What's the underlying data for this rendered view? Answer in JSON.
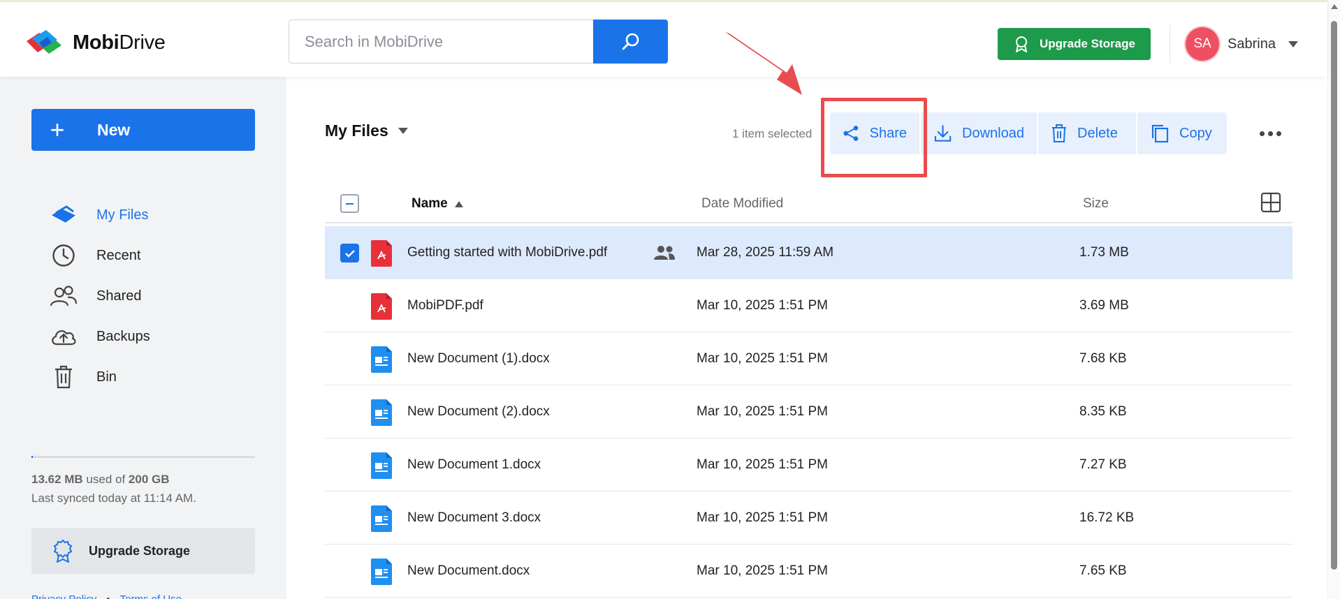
{
  "app": {
    "name_bold": "Mobi",
    "name_rest": "Drive"
  },
  "header": {
    "search_placeholder": "Search in MobiDrive",
    "upgrade_label": "Upgrade Storage",
    "user_initials": "SA",
    "user_name": "Sabrina"
  },
  "sidebar": {
    "new_label": "New",
    "items": [
      {
        "label": "My Files",
        "icon": "cloud-icon",
        "active": true
      },
      {
        "label": "Recent",
        "icon": "clock-icon",
        "active": false
      },
      {
        "label": "Shared",
        "icon": "people-icon",
        "active": false
      },
      {
        "label": "Backups",
        "icon": "cloud-upload-icon",
        "active": false
      },
      {
        "label": "Bin",
        "icon": "trash-icon",
        "active": false
      }
    ],
    "storage_used": "13.62 MB",
    "storage_used_of": " used of ",
    "storage_total": "200 GB",
    "storage_fraction": 0.0001,
    "sync_text": "Last synced today at 11:14 AM.",
    "upgrade_label": "Upgrade Storage",
    "footer_links": [
      "Privacy Policy",
      "Terms of Use"
    ]
  },
  "main": {
    "breadcrumb": "My Files",
    "selected_info": "1 item selected",
    "toolbar": {
      "share": "Share",
      "download": "Download",
      "delete": "Delete",
      "copy": "Copy"
    },
    "columns": {
      "name": "Name",
      "date": "Date Modified",
      "size": "Size"
    },
    "files": [
      {
        "name": "Getting started with MobiDrive.pdf",
        "type": "pdf",
        "date": "Mar 28, 2025 11:59 AM",
        "size": "1.73 MB",
        "selected": true,
        "shared": true
      },
      {
        "name": "MobiPDF.pdf",
        "type": "pdf",
        "date": "Mar 10, 2025 1:51 PM",
        "size": "3.69 MB",
        "selected": false,
        "shared": false
      },
      {
        "name": "New Document (1).docx",
        "type": "docx",
        "date": "Mar 10, 2025 1:51 PM",
        "size": "7.68 KB",
        "selected": false,
        "shared": false
      },
      {
        "name": "New Document (2).docx",
        "type": "docx",
        "date": "Mar 10, 2025 1:51 PM",
        "size": "8.35 KB",
        "selected": false,
        "shared": false
      },
      {
        "name": "New Document 1.docx",
        "type": "docx",
        "date": "Mar 10, 2025 1:51 PM",
        "size": "7.27 KB",
        "selected": false,
        "shared": false
      },
      {
        "name": "New Document 3.docx",
        "type": "docx",
        "date": "Mar 10, 2025 1:51 PM",
        "size": "16.72 KB",
        "selected": false,
        "shared": false
      },
      {
        "name": "New Document.docx",
        "type": "docx",
        "date": "Mar 10, 2025 1:51 PM",
        "size": "7.65 KB",
        "selected": false,
        "shared": false
      }
    ]
  },
  "colors": {
    "accent": "#1a73e8",
    "upgrade_green": "#1e9a4b",
    "avatar": "#ef4f63",
    "highlight_red": "#e84c4f",
    "pdf_red": "#e8303b",
    "docx_blue": "#1f8ff0"
  }
}
